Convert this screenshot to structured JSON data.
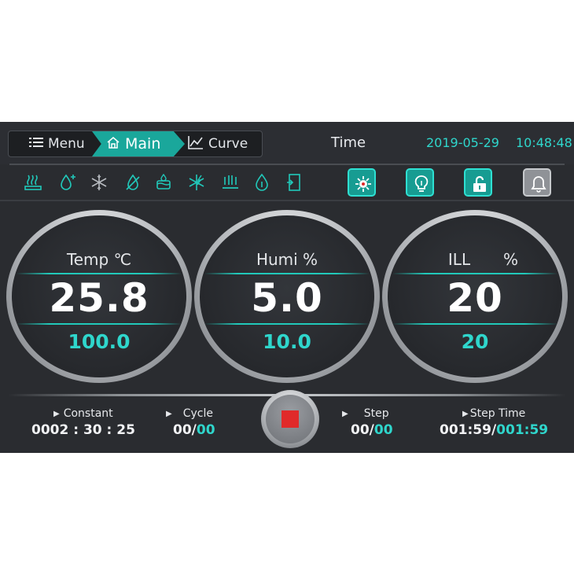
{
  "nav": {
    "menu_label": "Menu",
    "main_label": "Main",
    "curve_label": "Curve"
  },
  "header": {
    "time_label": "Time",
    "date": "2019-05-29",
    "clock": "10:48:48"
  },
  "status_icons": [
    "heater-icon",
    "humidifier-icon",
    "refrigeration-icon",
    "dehumidifier-icon",
    "water-tank-icon",
    "defrost-icon",
    "lighting-element-icon",
    "water-drop-icon",
    "door-icon"
  ],
  "toggle_buttons": [
    "fault-alert-button",
    "light-button",
    "lock-button",
    "alarm-bell-button"
  ],
  "gauges": {
    "temp": {
      "title": "Temp ℃",
      "value": "25.8",
      "setpoint": "100.0"
    },
    "humi": {
      "title": "Humi %",
      "value": "5.0",
      "setpoint": "10.0"
    },
    "ill": {
      "title": "ILL",
      "unit": "%",
      "value": "20",
      "setpoint": "20"
    }
  },
  "bottom": {
    "constant_label": "Constant",
    "constant_value": "0002 : 30 : 25",
    "cycle_label": "Cycle",
    "cycle_current": "00",
    "cycle_total": "00",
    "step_label": "Step",
    "step_current": "00",
    "step_total": "00",
    "steptime_label": "Step Time",
    "steptime_elapsed": "001:59",
    "steptime_total": "001:59",
    "separator": "/"
  },
  "colors": {
    "accent": "#1aa79b",
    "value_teal": "#2fd6cc",
    "stop_red": "#e02a2a",
    "background": "#2a2c30"
  }
}
